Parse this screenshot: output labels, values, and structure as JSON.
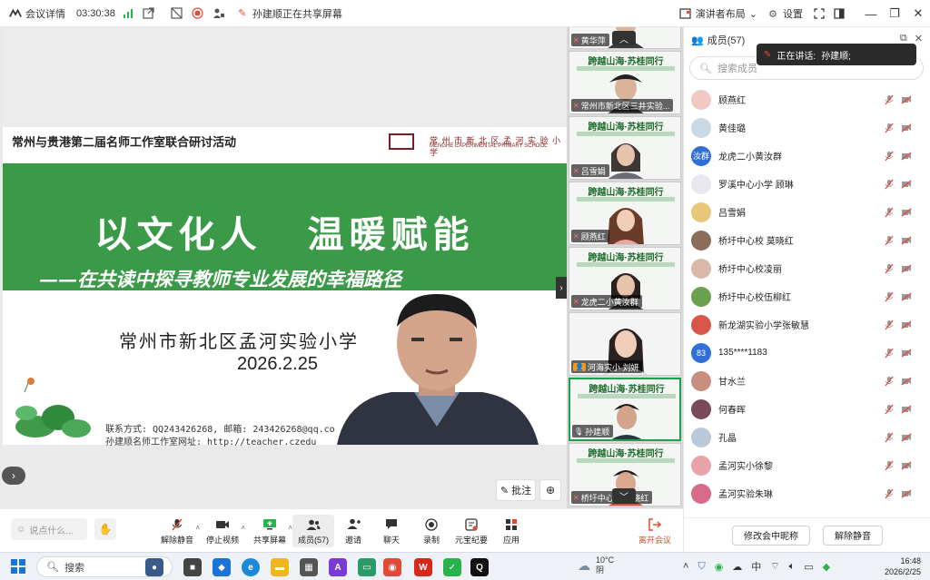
{
  "topbar": {
    "meeting_info": "会议详情",
    "timer": "03:30:38",
    "sharing_status": "孙建顺正在共享屏幕",
    "presenter_layout": "演讲者布局",
    "settings": "设置"
  },
  "slide": {
    "event_title": "常州与贵港第二届名师工作室联合研讨活动",
    "school_cn": "常 州 市 新 北 区 孟 河 实 验 小 学",
    "school_en": "MENGHE EXPERIMENTAL PRIMARY SCHOOL",
    "main_title": "以文化人 温暖赋能",
    "subtitle": "——在共读中探寻教师专业发展的幸福路径",
    "school_name": "常州市新北区孟河实验小学",
    "date": "2026.2.25",
    "contact_line1": "联系方式: QQ243426268, 邮箱: 243426268@qq.co",
    "contact_line2": "孙建顺名师工作室网址: http://teacher.czedu"
  },
  "stage": {
    "annotate_label": "批注"
  },
  "video_strip": {
    "banner_text": "跨越山海·苏桂同行",
    "tiles": [
      {
        "name": "黄华萍"
      },
      {
        "name": "常州市新北区三井实验..."
      },
      {
        "name": "吕雪娟"
      },
      {
        "name": "顾燕红"
      },
      {
        "name": "龙虎二小黄汝群"
      },
      {
        "name": "河海实小 刘妍"
      },
      {
        "name": "孙建顺"
      },
      {
        "name": "桥圩中心校 莫晓红"
      }
    ]
  },
  "members": {
    "title": "成员(57)",
    "search_placeholder": "搜索成员",
    "speaking_label": "正在讲话:",
    "speaking_name": "孙建顺;",
    "list": [
      {
        "name": "顾燕红",
        "avatar_color": "#f2c9c2",
        "avatar_text": ""
      },
      {
        "name": "黄佳璐",
        "avatar_color": "#c9d9e6",
        "avatar_text": ""
      },
      {
        "name": "龙虎二小黄汝群",
        "avatar_color": "#2f6fd6",
        "avatar_text": "汝群"
      },
      {
        "name": "罗溪中心小学 顾琳",
        "avatar_color": "#e8e8f2",
        "avatar_text": ""
      },
      {
        "name": "吕雪娟",
        "avatar_color": "#e8c77a",
        "avatar_text": ""
      },
      {
        "name": "桥圩中心校 莫晓红",
        "avatar_color": "#8a6d5a",
        "avatar_text": ""
      },
      {
        "name": "桥圩中心校凌丽",
        "avatar_color": "#d9b8a8",
        "avatar_text": ""
      },
      {
        "name": "桥圩中心校伍柳红",
        "avatar_color": "#6aa04f",
        "avatar_text": ""
      },
      {
        "name": "新龙湖实验小学张敏慧",
        "avatar_color": "#d9564a",
        "avatar_text": ""
      },
      {
        "name": "135****1183",
        "avatar_color": "#2f6fd6",
        "avatar_text": "83"
      },
      {
        "name": "甘水兰",
        "avatar_color": "#c98d7c",
        "avatar_text": ""
      },
      {
        "name": "何春晖",
        "avatar_color": "#7a4a5a",
        "avatar_text": ""
      },
      {
        "name": "孔晶",
        "avatar_color": "#b9c9d9",
        "avatar_text": ""
      },
      {
        "name": "孟河实小徐黎",
        "avatar_color": "#e7a3a8",
        "avatar_text": ""
      },
      {
        "name": "孟河实验朱琳",
        "avatar_color": "#d86a8a",
        "avatar_text": ""
      }
    ],
    "rename_button": "修改会中昵称",
    "unmute_button": "解除静音"
  },
  "toolbar": {
    "chat_placeholder": "说点什么...",
    "tools": [
      {
        "label": "解除静音",
        "icon": "mic-off-icon"
      },
      {
        "label": "停止视频",
        "icon": "video-icon"
      },
      {
        "label": "共享屏幕",
        "icon": "share-screen-icon"
      },
      {
        "label": "成员(57)",
        "icon": "members-icon"
      },
      {
        "label": "邀请",
        "icon": "invite-icon"
      },
      {
        "label": "聊天",
        "icon": "chat-icon"
      },
      {
        "label": "录制",
        "icon": "record-icon"
      },
      {
        "label": "元宝纪要",
        "icon": "summary-icon"
      },
      {
        "label": "应用",
        "icon": "apps-icon"
      }
    ],
    "leave_label": "离开会议"
  },
  "taskbar": {
    "search_label": "搜索",
    "temperature": "10°C",
    "weather": "阴",
    "ime": "中",
    "time": "16:48",
    "date": "2026/2/25"
  },
  "colors": {
    "slide_green": "#3a9a47",
    "active_border": "#1aa34a",
    "muted_red": "#e64b3c",
    "leave_red": "#e04a2f"
  }
}
